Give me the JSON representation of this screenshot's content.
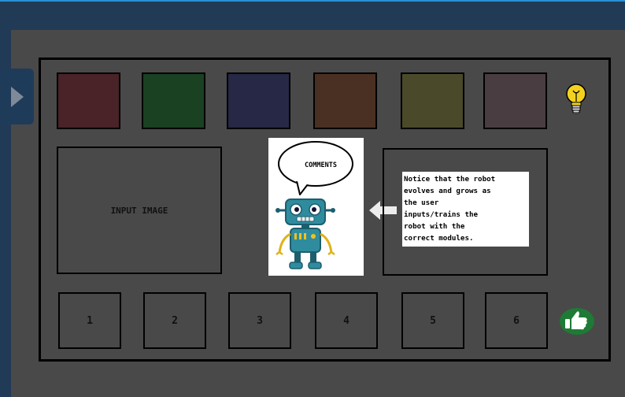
{
  "colors": {
    "frame": "#213a55",
    "frame_top_line": "#2a8fd6",
    "background": "#494949"
  },
  "palette": [
    {
      "name": "red",
      "color": "#492327"
    },
    {
      "name": "green",
      "color": "#1a4122"
    },
    {
      "name": "navy",
      "color": "#262845"
    },
    {
      "name": "brown",
      "color": "#4a3022"
    },
    {
      "name": "olive",
      "color": "#4a4a2a"
    },
    {
      "name": "mauve",
      "color": "#4a3d42"
    }
  ],
  "input_panel": {
    "label": "INPUT IMAGE"
  },
  "robot": {
    "bubble_text": "COMMENTS"
  },
  "note": {
    "lines": [
      "Notice that the robot",
      "evolves and grows as",
      "the user",
      "inputs/trains the",
      "robot with the",
      "correct modules."
    ]
  },
  "modules": [
    "1",
    "2",
    "3",
    "4",
    "5",
    "6"
  ],
  "icons": {
    "sidebar_toggle": "play-arrow-icon",
    "hint": "lightbulb-icon",
    "approve": "thumbs-up-icon",
    "pointer": "left-arrow-icon"
  }
}
